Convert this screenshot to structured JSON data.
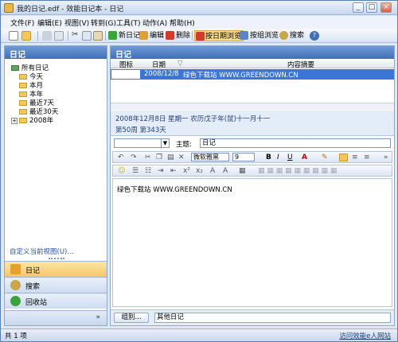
{
  "window": {
    "title": "我的日记.edf - 效能日记本 - 日记"
  },
  "menu": [
    "文件(F)",
    "编辑(E)",
    "视图(V)",
    "转到(G)",
    "工具(T)",
    "动作(A)",
    "帮助(H)"
  ],
  "toolbar": {
    "new_diary": "新日记",
    "edit": "编辑",
    "delete": "删除",
    "browse_by_date": "按日期浏览",
    "browse_by_group": "按组浏览",
    "search": "搜索"
  },
  "left_panel": {
    "title": "日记",
    "tree": {
      "root": "所有日记",
      "items": [
        "今天",
        "本月",
        "本年",
        "最近7天",
        "最近30天"
      ],
      "year": "2008年"
    },
    "custom_view_link": "自定义当前视图(U)...",
    "nav": {
      "diary": "日记",
      "search": "搜索",
      "recycle": "回收站"
    }
  },
  "right_panel": {
    "title": "日记",
    "columns": {
      "icon": "图标",
      "date": "日期",
      "summary": "内容摘要"
    },
    "row": {
      "date": "2008/12/8",
      "summary": "绿色下载站 WWW.GREENDOWN.CN"
    },
    "date_line": "2008年12月8日 星期一 农历戊子年(鼠)十一月十一",
    "week_line": "第50周 第343天",
    "topic_label": "主题:",
    "topic_value": "日记",
    "font_name": "微软雅黑",
    "font_size": "9",
    "editor_text": "绿色下载站 WWW.GREENDOWN.CN",
    "group_button": "组别...",
    "group_value": "其他日记"
  },
  "status": {
    "count": "共 1 项",
    "link": "访问效能e人网站"
  },
  "colors": {
    "selection": "#3b75d6",
    "header": "#3f6fb8",
    "active_nav": "#f7c66a"
  }
}
